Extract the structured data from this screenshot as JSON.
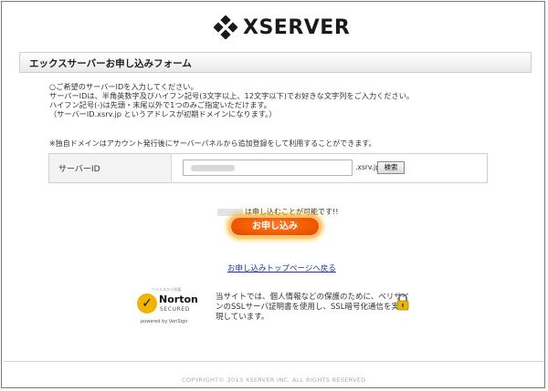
{
  "brand": {
    "logo_text": "XSERVER"
  },
  "form": {
    "title": "エックスサーバーお申し込みフォーム",
    "instructions": [
      "○ご希望のサーバーIDを入力してください。",
      "サーバーIDは、半角英数字及びハイフン記号(3文字以上、12文字以下)でお好きな文字列をご入力ください。",
      "ハイフン記号(-)は先頭・末尾以外で1つのみご指定いただけます。",
      "（サーバーID.xsrv.jp というアドレスが初期ドメインになります。）"
    ],
    "note": "※独自ドメインはアカウント発行後にサーバーパネルから追加登録をして利用することができます。",
    "server_id_label": "サーバーID",
    "server_id_value": "",
    "domain_suffix": ".xsrv.jp",
    "search_button": "検索",
    "availability": "は申し込むことが可能です!!",
    "apply_button": "お申し込み",
    "back_link": "お申し込みトップページへ戻る"
  },
  "norton": {
    "small_label": "ウイルスから保護",
    "word": "Norton",
    "secured": "SECURED",
    "powered": "powered by VeriSign"
  },
  "ssl_text": [
    "当サイトでは、個人情報などの保護のために、ベリサイ",
    "ンのSSLサーバ証明書を使用し、SSL暗号化通信を実",
    "現しています。"
  ],
  "footer": "COPYRIGHT© 2013 XSERVER INC. ALL RIGHTS RESERVED.",
  "colors": {
    "accent": "#f05a00",
    "link": "#1a33aa"
  }
}
